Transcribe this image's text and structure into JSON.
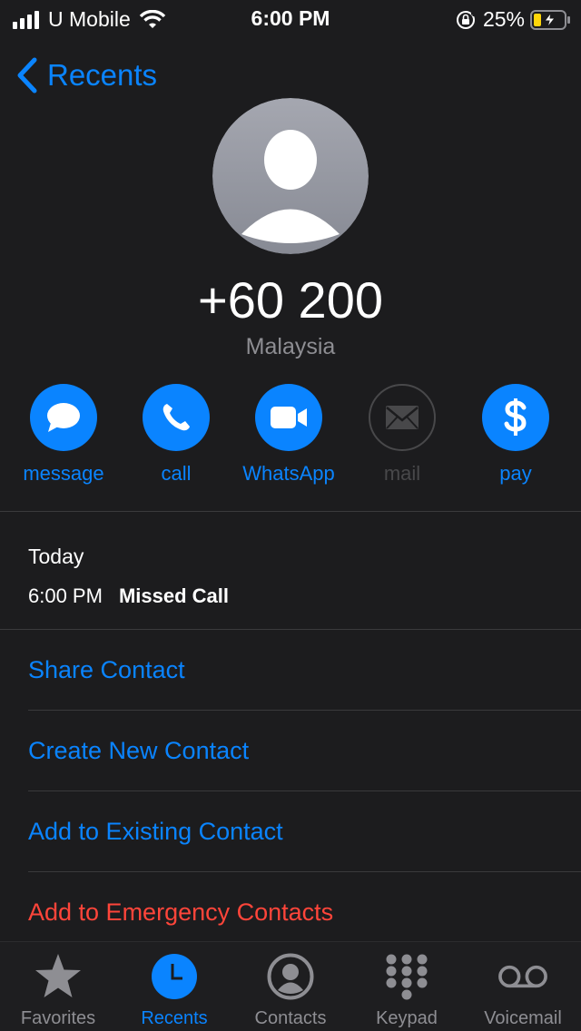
{
  "status_bar": {
    "carrier": "U Mobile",
    "time": "6:00 PM",
    "battery_percent": "25%",
    "battery_level": 0.25,
    "signal_bars": 4,
    "wifi": true,
    "orientation_lock": true,
    "charging": true
  },
  "nav": {
    "back_label": "Recents",
    "back_icon": "chevron-left-icon"
  },
  "contact": {
    "avatar_icon": "person-placeholder-icon",
    "number": "+60 200",
    "country": "Malaysia"
  },
  "actions": [
    {
      "label": "message",
      "icon": "message-bubble-icon",
      "enabled": true
    },
    {
      "label": "call",
      "icon": "phone-icon",
      "enabled": true
    },
    {
      "label": "WhatsApp",
      "icon": "video-camera-icon",
      "enabled": true
    },
    {
      "label": "mail",
      "icon": "envelope-icon",
      "enabled": false
    },
    {
      "label": "pay",
      "icon": "dollar-icon",
      "enabled": true
    }
  ],
  "history": {
    "date": "Today",
    "entries": [
      {
        "time": "6:00 PM",
        "type": "Missed Call"
      }
    ]
  },
  "options": [
    {
      "label": "Share Contact",
      "style": "blue"
    },
    {
      "label": "Create New Contact",
      "style": "blue"
    },
    {
      "label": "Add to Existing Contact",
      "style": "blue"
    },
    {
      "label": "Add to Emergency Contacts",
      "style": "red"
    }
  ],
  "tab_bar": {
    "tabs": [
      {
        "label": "Favorites",
        "icon": "star-icon",
        "active": false
      },
      {
        "label": "Recents",
        "icon": "clock-icon",
        "active": true
      },
      {
        "label": "Contacts",
        "icon": "person-circle-icon",
        "active": false
      },
      {
        "label": "Keypad",
        "icon": "keypad-icon",
        "active": false
      },
      {
        "label": "Voicemail",
        "icon": "voicemail-icon",
        "active": false
      }
    ]
  },
  "colors": {
    "background": "#1c1c1e",
    "accent": "#0a84ff",
    "destructive": "#ff453a",
    "secondary_text": "#8e8e93",
    "battery_fill": "#ffd60a"
  }
}
